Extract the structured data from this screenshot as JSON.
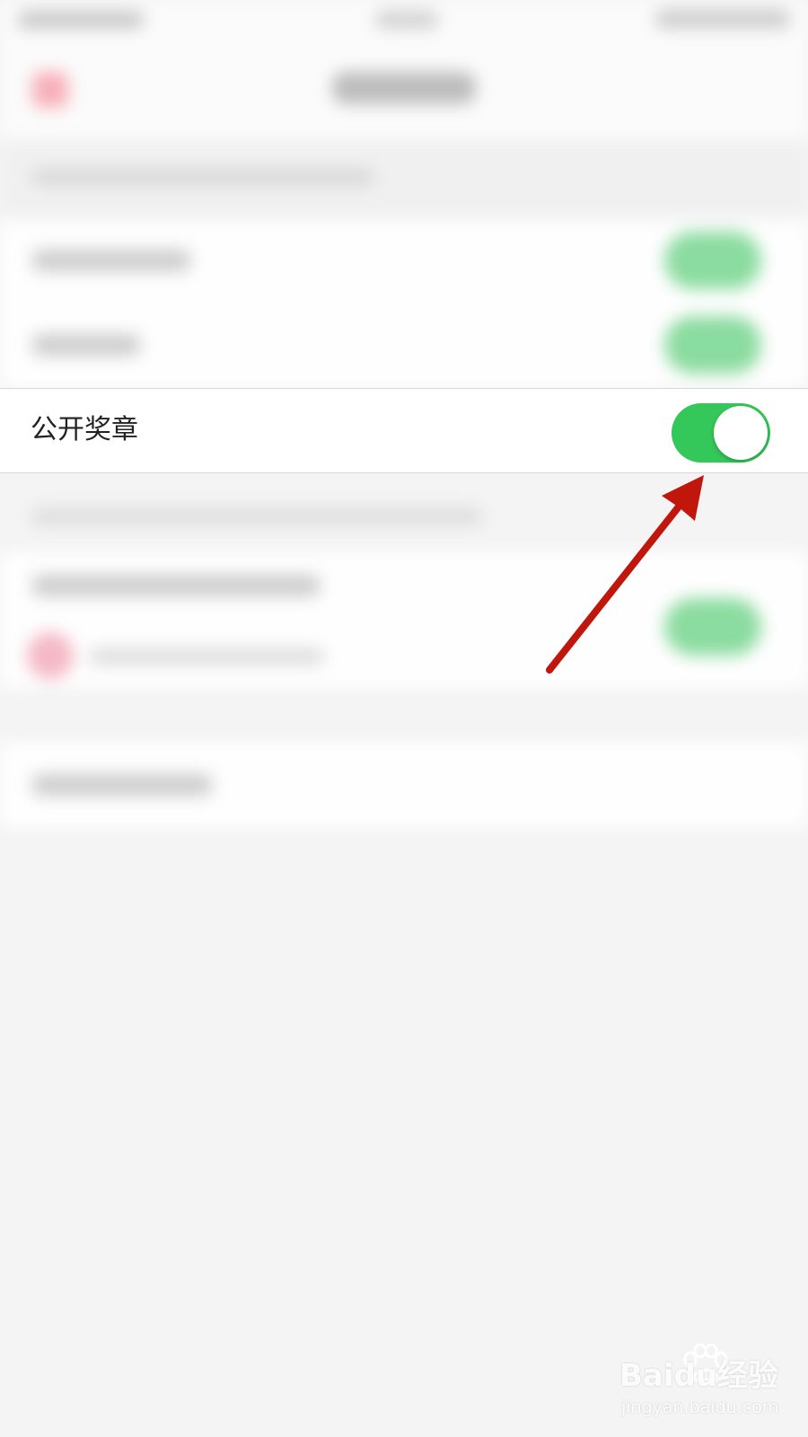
{
  "setting": {
    "label": "公开奖章",
    "toggle_on": true,
    "toggle_color": "#34c759"
  },
  "annotation": {
    "arrow_color": "#c0160c"
  },
  "watermark": {
    "brand": "Baidu经验",
    "url": "jingyan.baidu.com"
  }
}
